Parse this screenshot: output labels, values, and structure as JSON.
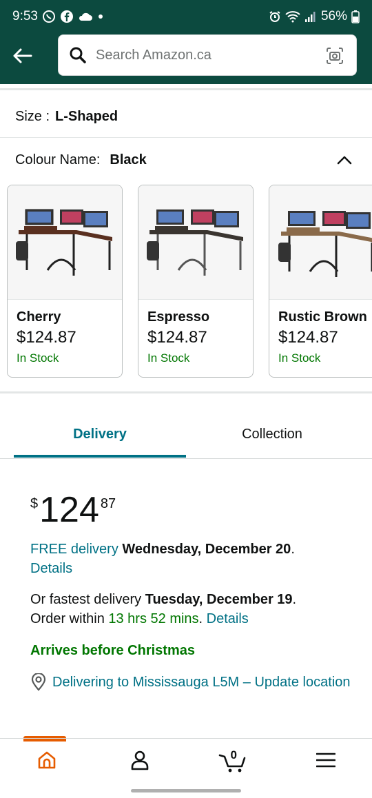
{
  "status_bar": {
    "time": "9:53",
    "battery": "56%"
  },
  "search": {
    "placeholder": "Search Amazon.ca"
  },
  "size": {
    "label": "Size :",
    "value": "L-Shaped"
  },
  "colour": {
    "label": "Colour Name:",
    "value": "Black"
  },
  "swatches": [
    {
      "name": "Cherry",
      "price": "$124.87",
      "stock": "In Stock"
    },
    {
      "name": "Espresso",
      "price": "$124.87",
      "stock": "In Stock"
    },
    {
      "name": "Rustic Brown",
      "price": "$124.87",
      "stock": "In Stock"
    }
  ],
  "tabs": {
    "delivery": "Delivery",
    "collection": "Collection"
  },
  "price": {
    "symbol": "$",
    "whole": "124",
    "fraction": "87"
  },
  "delivery": {
    "free_label": "FREE delivery",
    "free_date": "Wednesday, December 20",
    "details_link": "Details",
    "fastest_prefix": "Or fastest delivery",
    "fastest_date": "Tuesday, December 19",
    "order_within_prefix": "Order within",
    "order_within_time": "13 hrs 52 mins",
    "fastest_details_link": "Details",
    "arrives_note": "Arrives before Christmas",
    "location_text": "Delivering to Mississauga L5M – Update location"
  },
  "bottom_nav": {
    "cart_count": "0"
  },
  "colors": {
    "header_bg": "#0c4a3f",
    "link": "#007185",
    "in_stock": "#007600",
    "nav_accent": "#e65c00"
  }
}
